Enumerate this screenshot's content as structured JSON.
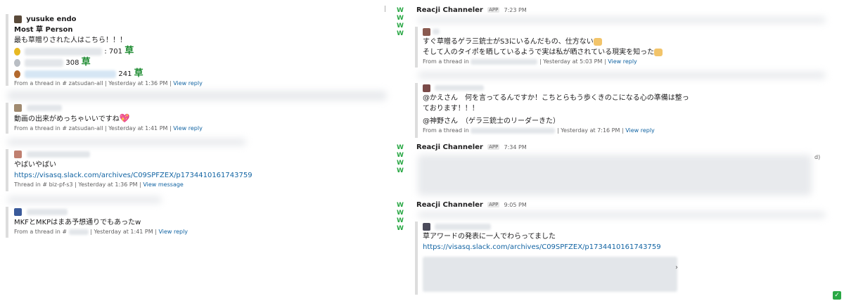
{
  "left": {
    "card1": {
      "user": "yusuke endo",
      "title": "Most 草 Person",
      "subtitle": "最も草贈りされた人はこちら！！！",
      "rank1_value": ": 701",
      "rank2_value": "308",
      "rank3_value": "241",
      "kusa": "草",
      "meta_prefix": "From a thread in",
      "channel": "# zatsudan-all",
      "timestamp": "Yesterday at 1:36 PM",
      "reply": "View reply"
    },
    "card2": {
      "message": "動画の出来がめっちゃいいですね",
      "meta_prefix": "From a thread in",
      "channel": "# zatsudan-all",
      "timestamp": "Yesterday at 1:41 PM",
      "reply": "View reply"
    },
    "card3": {
      "message": "やばいやばい",
      "link": "https://visasq.slack.com/archives/C09SPFZEX/p1734410161743759",
      "meta_prefix": "Thread in",
      "channel": "# biz-pf-s3",
      "timestamp": "Yesterday at 1:36 PM",
      "reply": "View message"
    },
    "card4": {
      "message": "MKFとMKPはまあ予想通りでもあったw",
      "meta_prefix": "From a thread in",
      "channel": "#",
      "timestamp": "Yesterday at 1:41 PM",
      "reply": "View reply"
    }
  },
  "right": {
    "post1": {
      "bot_icon": "W W\nW W",
      "bot_name": "Reacji Channeler",
      "app_badge": "APP",
      "time": "7:23 PM",
      "q1_line1": "すぐ草贈るゲラ三銃士がS3にいるんだもの、仕方ない",
      "q1_line2": "そして人のタイポを晒しているようで実は私が晒されている現実を知った",
      "q1_meta_prefix": "From a thread in",
      "q1_timestamp": "Yesterday at 5:03 PM",
      "q1_reply": "View reply",
      "q2_line1": "@かえさん　何を言ってるんですか！こちとらもう歩くきのこになる心の準備は整っ",
      "q2_line2": "ております！！！",
      "q2_line3": "@神野さん　（ゲラ三銃士のリーダーきた）",
      "q2_meta_prefix": "From a thread in",
      "q2_timestamp": "Yesterday at 7:16 PM",
      "q2_reply": "View reply"
    },
    "post2": {
      "bot_name": "Reacji Channeler",
      "app_badge": "APP",
      "time": "7:34 PM",
      "trail": "d)"
    },
    "post3": {
      "bot_name": "Reacji Channeler",
      "app_badge": "APP",
      "time": "9:05 PM",
      "message": "草アワードの発表に一人でわらってました",
      "link": "https://visasq.slack.com/archives/C09SPFZEX/p1734410161743759",
      "chevron": "›"
    }
  },
  "colors": {
    "link": "#1264a3",
    "kusa_green": "#1b8a2f",
    "bot_green": "#2aa845",
    "quote_bar": "#dddddd",
    "meta_gray": "#616061"
  },
  "icons": [
    "medal-gold-icon",
    "medal-silver-icon",
    "medal-bronze-icon",
    "heart-icon",
    "cat-emoji-icon",
    "check-icon"
  ]
}
